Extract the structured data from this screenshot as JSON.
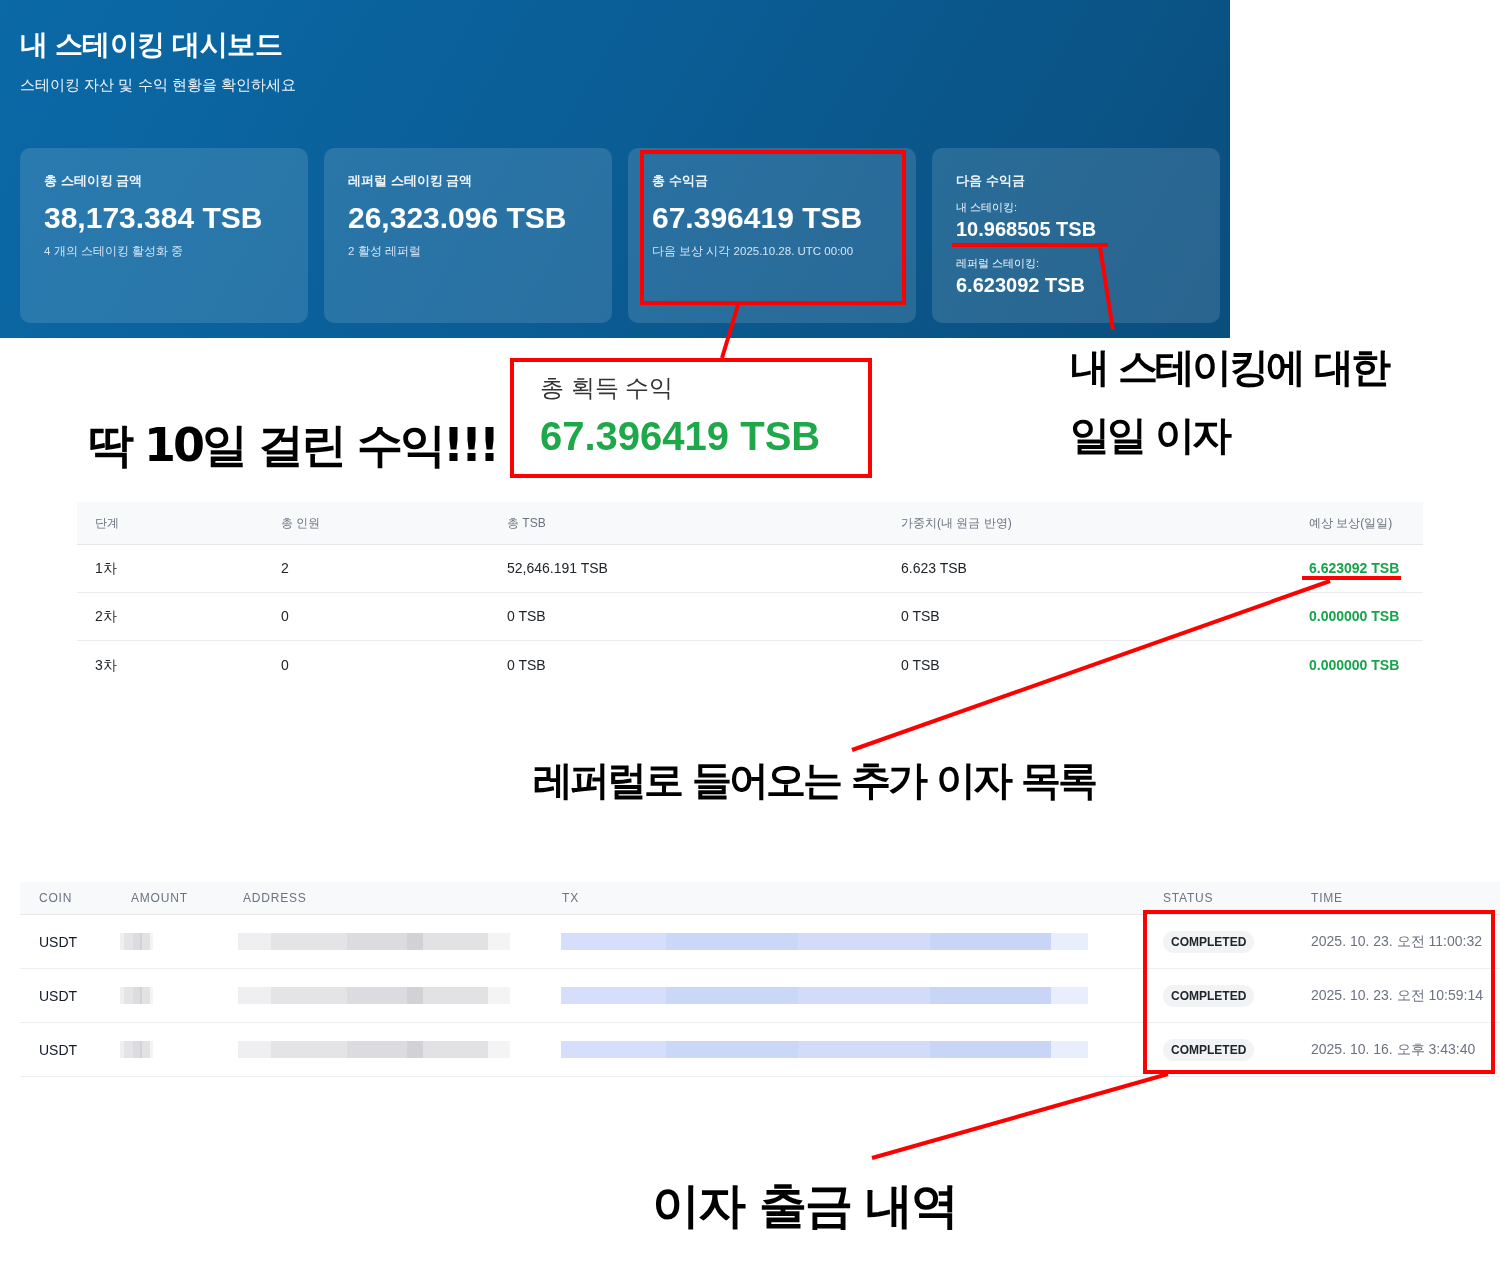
{
  "header": {
    "title": "내 스테이킹 대시보드",
    "subtitle": "스테이킹 자산 및 수익 현황을 확인하세요"
  },
  "cards": [
    {
      "kind": "single",
      "label": "총 스테이킹 금액",
      "value": "38,173.384 TSB",
      "note": "4 개의 스테이킹 활성화 중",
      "highlighted": false
    },
    {
      "kind": "single",
      "label": "레퍼럴 스테이킹 금액",
      "value": "26,323.096 TSB",
      "note": "2 활성 레퍼럴",
      "highlighted": false
    },
    {
      "kind": "single",
      "label": "총 수익금",
      "value": "67.396419 TSB",
      "note": "다음 보상 시각 2025.10.28. UTC 00:00",
      "highlighted": true
    },
    {
      "kind": "split",
      "label": "다음 수익금",
      "highlighted": false,
      "entries": [
        {
          "label": "내 스테이킹:",
          "value": "10.968505 TSB",
          "underlined": true
        },
        {
          "label": "레퍼럴 스테이킹:",
          "value": "6.623092 TSB",
          "underlined": false
        }
      ]
    }
  ],
  "referral_table": {
    "columns": [
      {
        "label": "단계",
        "kind": "text"
      },
      {
        "label": "총 인원",
        "kind": "text"
      },
      {
        "label": "총 TSB",
        "kind": "text"
      },
      {
        "label": "가중치(내 원금 반영)",
        "kind": "text"
      },
      {
        "label": "예상 보상(일일)",
        "kind": "reward"
      }
    ],
    "rows": [
      {
        "cells": [
          "1차",
          "2",
          "52,646.191 TSB",
          "6.623 TSB",
          "6.623092 TSB"
        ],
        "underlined": true
      },
      {
        "cells": [
          "2차",
          "0",
          "0 TSB",
          "0 TSB",
          "0.000000 TSB"
        ],
        "underlined": false
      },
      {
        "cells": [
          "3차",
          "0",
          "0 TSB",
          "0 TSB",
          "0.000000 TSB"
        ],
        "underlined": false
      }
    ]
  },
  "withdrawals": {
    "columns": [
      {
        "label": "COIN",
        "kind": "text",
        "highlighted": false
      },
      {
        "label": "AMOUNT",
        "kind": "redacted",
        "highlighted": false
      },
      {
        "label": "ADDRESS",
        "kind": "redacted",
        "highlighted": false
      },
      {
        "label": "TX",
        "kind": "redacted-link",
        "highlighted": false
      },
      {
        "label": "STATUS",
        "kind": "badge",
        "highlighted": true
      },
      {
        "label": "TIME",
        "kind": "time",
        "highlighted": true
      }
    ],
    "rows": [
      {
        "cells": [
          "USDT",
          "COMPLETED",
          "2025. 10. 23. 오전 11:00:32"
        ]
      },
      {
        "cells": [
          "USDT",
          "COMPLETED",
          "2025. 10. 23. 오전 10:59:14"
        ]
      },
      {
        "cells": [
          "USDT",
          "COMPLETED",
          "2025. 10. 16. 오후 3:43:40"
        ]
      }
    ]
  },
  "annotations": [
    {
      "kind": "callout",
      "label": "총 획득 수익",
      "value": "67.396419 TSB"
    },
    {
      "kind": "caption",
      "text": "딱 10일 걸린 수익!!!"
    },
    {
      "kind": "caption",
      "text": "내 스테이킹에 대한 일일 이자"
    },
    {
      "kind": "caption",
      "text": "레퍼럴로 들어오는 추가 이자 목록"
    },
    {
      "kind": "caption",
      "text": "이자 출금 내역"
    }
  ]
}
